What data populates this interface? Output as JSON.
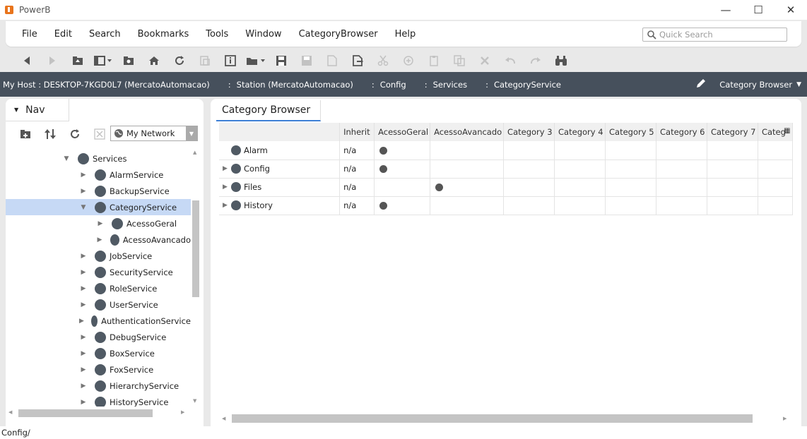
{
  "window": {
    "title": "PowerB",
    "minimize": "—",
    "maximize": "☐",
    "close": "✕"
  },
  "menu": {
    "items": [
      "File",
      "Edit",
      "Search",
      "Bookmarks",
      "Tools",
      "Window",
      "CategoryBrowser",
      "Help"
    ]
  },
  "quick_search": {
    "placeholder": "Quick Search"
  },
  "toolbar": {
    "icons": [
      "back-icon",
      "forward-icon",
      "up-level-icon",
      "side-bar-icon",
      "folder-target-icon",
      "home-icon",
      "refresh-icon",
      "replace-icon",
      "info-icon",
      "open-icon",
      "save-icon",
      "save-all-icon",
      "export-icon",
      "publish-icon",
      "cut-icon",
      "copy-icon",
      "paste-icon",
      "duplicate-icon",
      "delete-icon",
      "undo-icon",
      "redo-icon",
      "find-icon"
    ]
  },
  "breadcrumb": {
    "items": [
      "My Host : DESKTOP-7KGD0L7 (MercatoAutomacao)",
      "Station (MercatoAutomacao)",
      "Config",
      "Services",
      "CategoryService"
    ],
    "view_name": "Category Browser"
  },
  "nav": {
    "tab_label": "Nav",
    "network_select": "My Network",
    "tree": [
      {
        "label": "Services",
        "indent": 0,
        "expanded": true
      },
      {
        "label": "AlarmService",
        "indent": 1
      },
      {
        "label": "BackupService",
        "indent": 1
      },
      {
        "label": "CategoryService",
        "indent": 1,
        "expanded": true,
        "selected": true
      },
      {
        "label": "AcessoGeral",
        "indent": 2
      },
      {
        "label": "AcessoAvancado",
        "indent": 2
      },
      {
        "label": "JobService",
        "indent": 1
      },
      {
        "label": "SecurityService",
        "indent": 1
      },
      {
        "label": "RoleService",
        "indent": 1
      },
      {
        "label": "UserService",
        "indent": 1
      },
      {
        "label": "AuthenticationService",
        "indent": 1
      },
      {
        "label": "DebugService",
        "indent": 1
      },
      {
        "label": "BoxService",
        "indent": 1
      },
      {
        "label": "FoxService",
        "indent": 1
      },
      {
        "label": "HierarchyService",
        "indent": 1
      },
      {
        "label": "HistoryService",
        "indent": 1
      }
    ]
  },
  "main": {
    "tab_label": "Category Browser",
    "columns": [
      "",
      "Inherit",
      "AcessoGeral",
      "AcessoAvancado",
      "Category 3",
      "Category 4",
      "Category 5",
      "Category 6",
      "Category 7",
      "Categ"
    ],
    "rows": [
      {
        "name": "Alarm",
        "expandable": false,
        "inherit": "n/a",
        "marks": [
          true,
          false,
          false,
          false,
          false,
          false,
          false,
          false
        ]
      },
      {
        "name": "Config",
        "expandable": true,
        "inherit": "n/a",
        "marks": [
          true,
          false,
          false,
          false,
          false,
          false,
          false,
          false
        ]
      },
      {
        "name": "Files",
        "expandable": true,
        "inherit": "n/a",
        "marks": [
          false,
          true,
          false,
          false,
          false,
          false,
          false,
          false
        ]
      },
      {
        "name": "History",
        "expandable": true,
        "inherit": "n/a",
        "marks": [
          true,
          false,
          false,
          false,
          false,
          false,
          false,
          false
        ]
      }
    ]
  },
  "status": {
    "text": "Config/"
  }
}
